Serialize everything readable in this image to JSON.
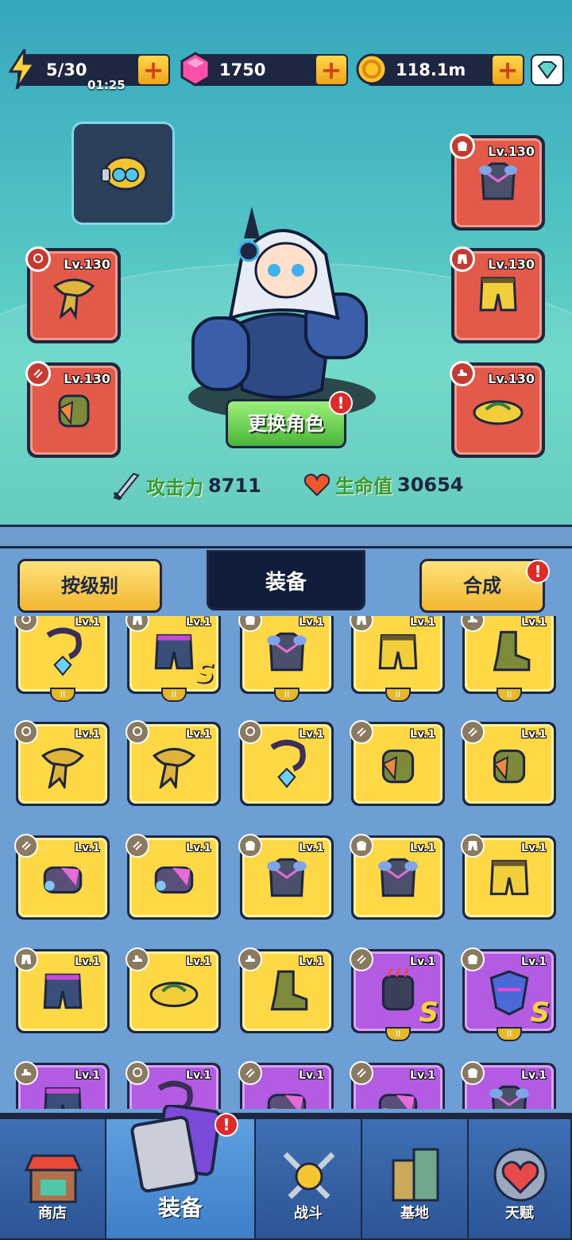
{
  "resources": {
    "energy": {
      "value": "5/30",
      "timer": "01:25",
      "icon": "lightning-icon"
    },
    "gems": {
      "value": "1750",
      "icon": "pink-gem-icon"
    },
    "coins": {
      "value": "118.1m",
      "icon": "gold-coin-icon"
    }
  },
  "hero": {
    "swap_label": "更换角色",
    "attack_label": "攻击力",
    "attack_value": "8711",
    "hp_label": "生命值",
    "hp_value": "30654"
  },
  "equipped": {
    "necklace": {
      "level": "Lv.130"
    },
    "gloves": {
      "level": "Lv.130"
    },
    "armor": {
      "level": "Lv.130"
    },
    "pants": {
      "level": "Lv.130"
    },
    "shoes": {
      "level": "Lv.130"
    }
  },
  "tabs": {
    "sort": "按级别",
    "equipment": "装备",
    "merge": "合成"
  },
  "inventory": {
    "level": "Lv.1",
    "rank_s": "S"
  },
  "nav": {
    "shop": "商店",
    "equipment": "装备",
    "battle": "战斗",
    "base": "基地",
    "talent": "天赋"
  },
  "colors": {
    "rarity_gold": "#ffd945",
    "rarity_purple": "#b35be3",
    "rarity_red": "#e35a4a",
    "alert": "#e02a2a"
  }
}
